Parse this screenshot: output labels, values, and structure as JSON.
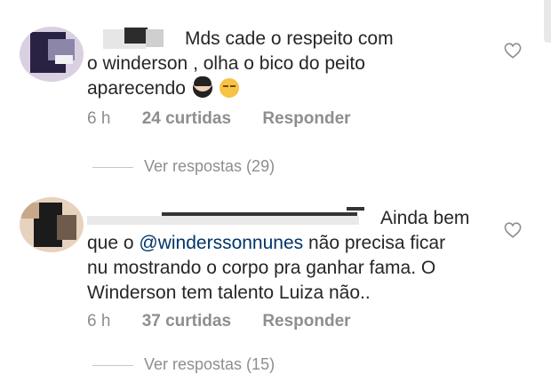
{
  "comments": [
    {
      "text": "Mds cade o respeito com o winderson , olha o bico do peito aparecendo",
      "text_line1": "Mds cade o respeito com",
      "text_line2": "o winderson , olha o bico do peito",
      "text_line3": "aparecendo",
      "emojis": [
        "woman-emoji",
        "pensive-face-emoji"
      ],
      "time": "6 h",
      "likes": "24 curtidas",
      "reply_label": "Responder",
      "view_replies": "Ver respostas (29)"
    },
    {
      "text_line1_tail": "Ainda bem",
      "text_line2_pre": "que o ",
      "mention": "@winderssonnunes",
      "text_line2_post": " não precisa ficar",
      "text_line3": "nu mostrando o corpo pra ganhar fama. O",
      "text_line4": "Winderson tem talento Luiza não..",
      "time": "6 h",
      "likes": "37 curtidas",
      "reply_label": "Responder",
      "view_replies": "Ver respostas (15)"
    }
  ],
  "icons": {
    "like": "heart-outline-icon"
  },
  "colors": {
    "text": "#262626",
    "secondary": "#8e8e8e",
    "mention": "#003569"
  }
}
